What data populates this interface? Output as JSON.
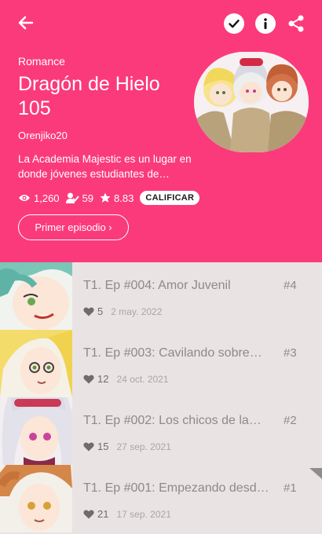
{
  "colors": {
    "accent": "#fb3a7c",
    "list_bg": "#e9e3e4",
    "muted_text": "#8d8a8b"
  },
  "header": {
    "genre": "Romance",
    "title": "Dragón de Hielo 105",
    "author": "Orenjiko20",
    "description": "La Academia Majestic es un lugar en donde jóvenes estudiantes de…",
    "stats": {
      "views": "1,260",
      "subscribers": "59",
      "rating": "8.83"
    },
    "rate_label": "CALIFICAR",
    "first_episode_label": "Primer episodio ›"
  },
  "toolbar": {
    "icons": [
      "back-arrow-icon",
      "check-circle-icon",
      "info-icon",
      "share-icon"
    ]
  },
  "episodes": [
    {
      "title": "T1. Ep #004: Amor Juvenil",
      "number": "#4",
      "likes": "5",
      "date": "2 may. 2022"
    },
    {
      "title": "T1. Ep #003: Cavilando sobre…",
      "number": "#3",
      "likes": "12",
      "date": "24 oct. 2021"
    },
    {
      "title": "T1. Ep #002: Los chicos de la…",
      "number": "#2",
      "likes": "15",
      "date": "27 sep. 2021"
    },
    {
      "title": "T1. Ep #001: Empezando desd…",
      "number": "#1",
      "likes": "21",
      "date": "17 sep. 2021"
    }
  ]
}
